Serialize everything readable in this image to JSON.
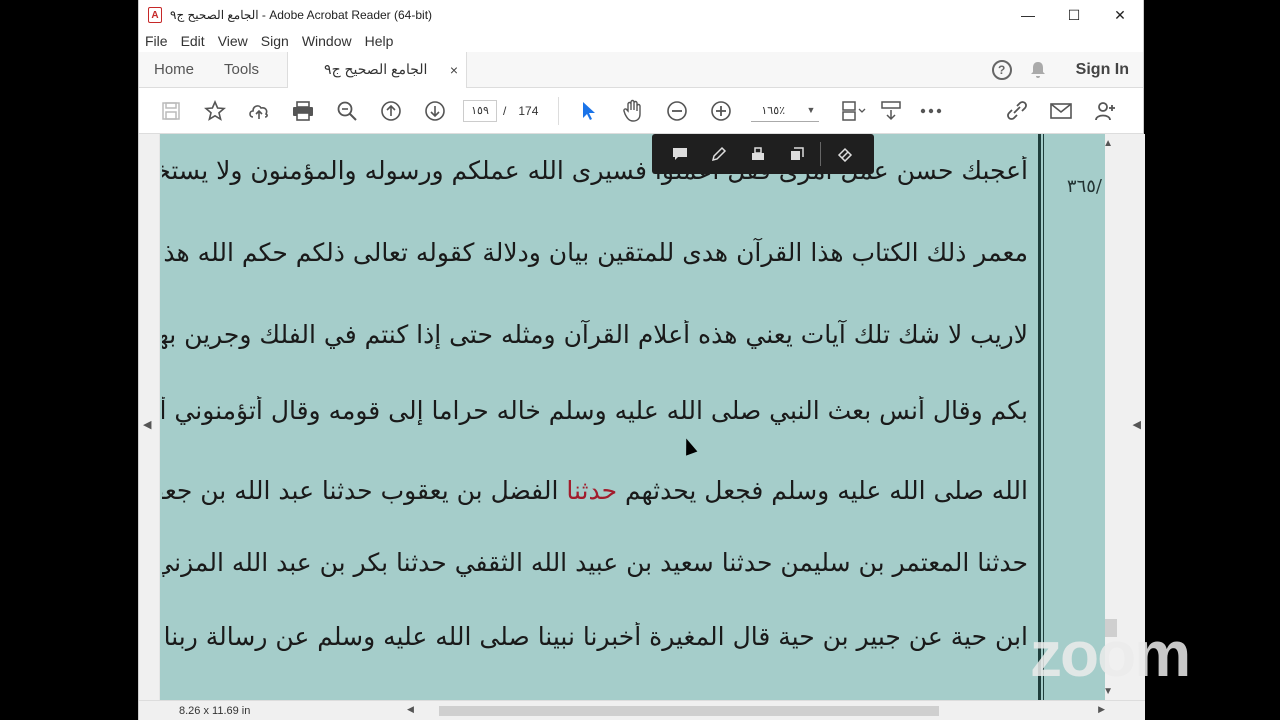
{
  "window": {
    "title": "الجامع الصحيح ج٩ - Adobe Acrobat Reader (64-bit)",
    "controls": {
      "minimize": "—",
      "maximize": "☐",
      "close": "✕"
    }
  },
  "menubar": {
    "items": [
      "File",
      "Edit",
      "View",
      "Sign",
      "Window",
      "Help"
    ]
  },
  "tabs": {
    "home": "Home",
    "tools": "Tools",
    "document": "الجامع الصحيح ج٩",
    "close": "×",
    "signin": "Sign In"
  },
  "toolbar": {
    "page_current": "١٥٩",
    "page_separator": "/",
    "page_total": "174",
    "zoom": "١٦٥٪",
    "icons": [
      "save-icon",
      "star-icon",
      "upload-icon",
      "print-icon",
      "search-icon",
      "page-up-icon",
      "page-down-icon",
      "select-cursor-icon",
      "hand-icon",
      "zoom-out-icon",
      "zoom-in-icon",
      "page-fit-icon",
      "scroll-mode-icon",
      "more-icon",
      "link-icon",
      "mail-icon",
      "add-user-icon"
    ]
  },
  "comment_toolbar": {
    "icons": [
      "comment-icon",
      "pencil-icon",
      "stamp-icon",
      "copy-icon",
      "highlight-eraser-icon"
    ]
  },
  "page": {
    "margin_number": "٣٦٥/",
    "lines": [
      "أعجبك حسن عمل امرئ فقل اعملوا فسيرى الله عملكم ورسوله والمؤمنون ولا يستخفنك أحد وقال",
      "معمر ذلك الكتاب هذا القرآن هدى للمتقين بيان ودلالة كقوله تعالى ذلكم حكم الله هذا حكم الله",
      "لاريب لا شك تلك آيات يعني هذه أعلام القرآن ومثله حتى إذا كنتم في الفلك وجرين بهم يعني",
      "بكم وقال أنس بعث النبي صلى الله عليه وسلم خاله حراما إلى قومه وقال أتؤمنوني أبلغ رسالة رسول",
      "الله صلى الله عليه وسلم فجعل يحدثهم حدثنا الفضل بن يعقوب حدثنا عبد الله بن جعفر الرقي",
      "حدثنا المعتمر بن سليمن حدثنا سعيد بن عبيد الله الثقفي حدثنا بكر بن عبد الله المزني وزياد بن جبير",
      "ابن حية عن جبير بن حية قال المغيرة أخبرنا نبينا صلى الله عليه وسلم عن رسالة ربنا أنه من قتل"
    ],
    "red_word": "حدثنا"
  },
  "status": {
    "dimensions": "8.26 x 11.69 in"
  },
  "overlay": {
    "zoom_logo": "zoom"
  }
}
